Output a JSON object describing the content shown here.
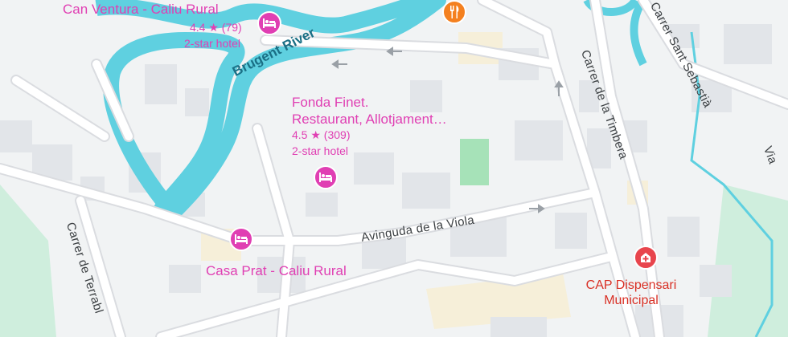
{
  "map": {
    "colors": {
      "background": "#f1f3f4",
      "road": "#ffffff",
      "road_edge": "#dadce0",
      "building": "#e2e5e9",
      "river": "#5fd0e0",
      "park": "#cfeedd",
      "pitch": "#a6e2b8",
      "block": "#f6efd9",
      "hotel_accent": "#e03fb3",
      "medical_accent": "#e8454d",
      "food_accent": "#f4801f"
    },
    "pois": [
      {
        "name": "Can Ventura - Caliu Rural",
        "rating": "4.4 ★ (79)",
        "category": "2-star hotel",
        "icon": "bed-icon"
      },
      {
        "name_line1": "Fonda Finet.",
        "name_line2": "Restaurant, Allotjament…",
        "rating": "4.5 ★ (309)",
        "category": "2-star hotel",
        "icon": "bed-icon"
      },
      {
        "name": "Casa Prat - Caliu Rural",
        "icon": "bed-icon"
      },
      {
        "name_line1": "CAP Dispensari",
        "name_line2": "Municipal",
        "icon": "medical-icon"
      },
      {
        "icon": "restaurant-icon"
      }
    ],
    "streets": [
      "Brugent River",
      "Avinguda de la Viola",
      "Carrer de la Timbera",
      "Carrer de Terrabl",
      "Carrer Sant Sebastià",
      "Via"
    ]
  }
}
